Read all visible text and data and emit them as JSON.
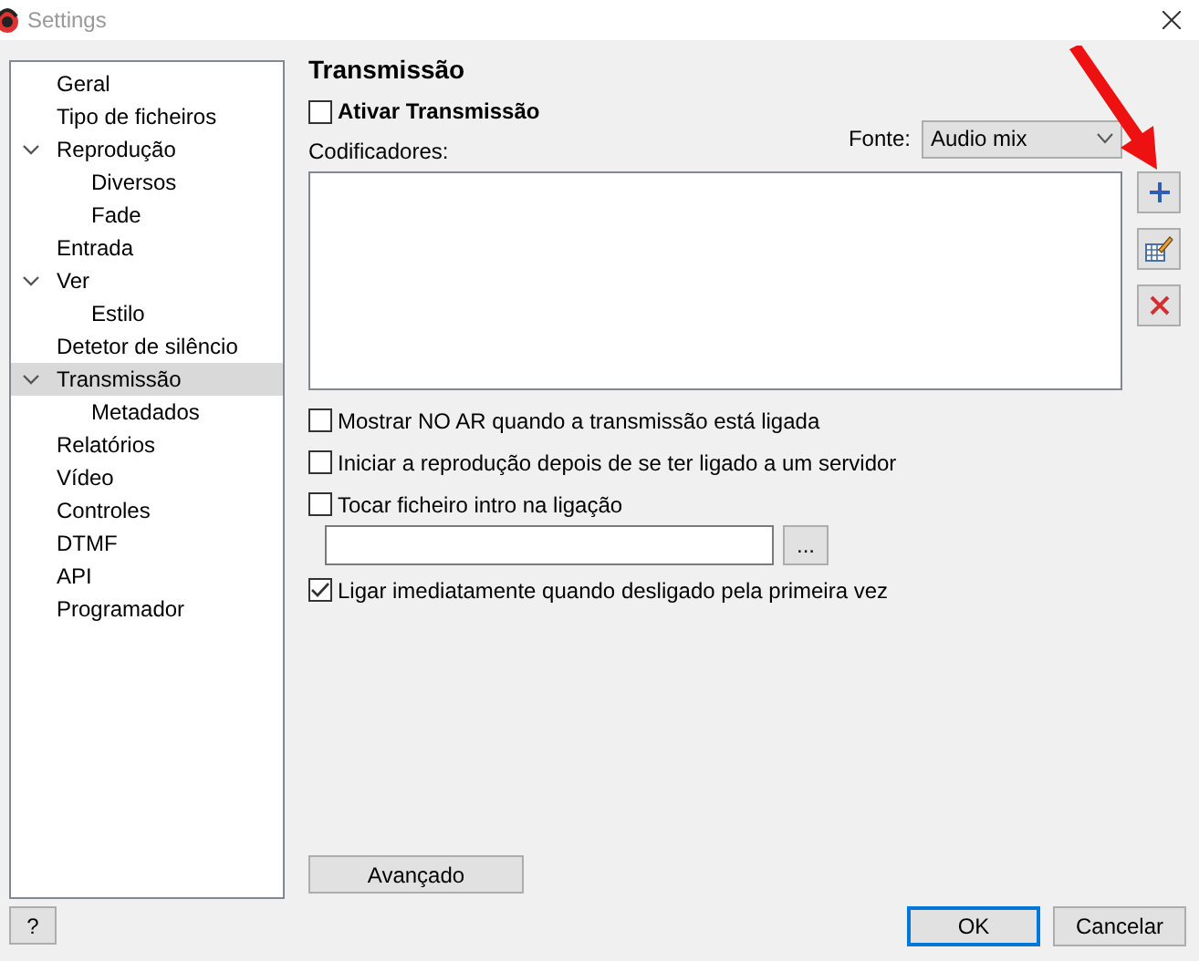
{
  "window": {
    "title": "Settings"
  },
  "sidebar": {
    "items": [
      {
        "label": "Geral",
        "selected": false
      },
      {
        "label": "Tipo de ficheiros",
        "selected": false
      },
      {
        "label": "Reprodução",
        "selected": false,
        "expanded": true,
        "children": [
          {
            "label": "Diversos",
            "selected": false
          },
          {
            "label": "Fade",
            "selected": false
          }
        ]
      },
      {
        "label": "Entrada",
        "selected": false
      },
      {
        "label": "Ver",
        "selected": false,
        "expanded": true,
        "children": [
          {
            "label": "Estilo",
            "selected": false
          }
        ]
      },
      {
        "label": "Detetor de silêncio",
        "selected": false
      },
      {
        "label": "Transmissão",
        "selected": true,
        "expanded": true,
        "children": [
          {
            "label": "Metadados",
            "selected": false
          }
        ]
      },
      {
        "label": "Relatórios",
        "selected": false
      },
      {
        "label": "Vídeo",
        "selected": false
      },
      {
        "label": "Controles",
        "selected": false
      },
      {
        "label": "DTMF",
        "selected": false
      },
      {
        "label": "API",
        "selected": false
      },
      {
        "label": "Programador",
        "selected": false
      }
    ]
  },
  "panel": {
    "heading": "Transmissão",
    "enable": {
      "label": "Ativar Transmissão",
      "checked": false
    },
    "source": {
      "label": "Fonte:",
      "value": "Audio mix"
    },
    "encoders_label": "Codificadores:",
    "options": [
      {
        "label": "Mostrar NO AR quando a transmissão está ligada",
        "checked": false
      },
      {
        "label": "Iniciar a reprodução depois de se ter ligado a um servidor",
        "checked": false
      },
      {
        "label": "Tocar ficheiro intro na ligação",
        "checked": false,
        "file": {
          "browse": "..."
        }
      },
      {
        "label": "Ligar imediatamente quando desligado pela primeira vez",
        "checked": true
      }
    ],
    "advanced": "Avançado"
  },
  "footer": {
    "help": "?",
    "ok": "OK",
    "cancel": "Cancelar"
  }
}
